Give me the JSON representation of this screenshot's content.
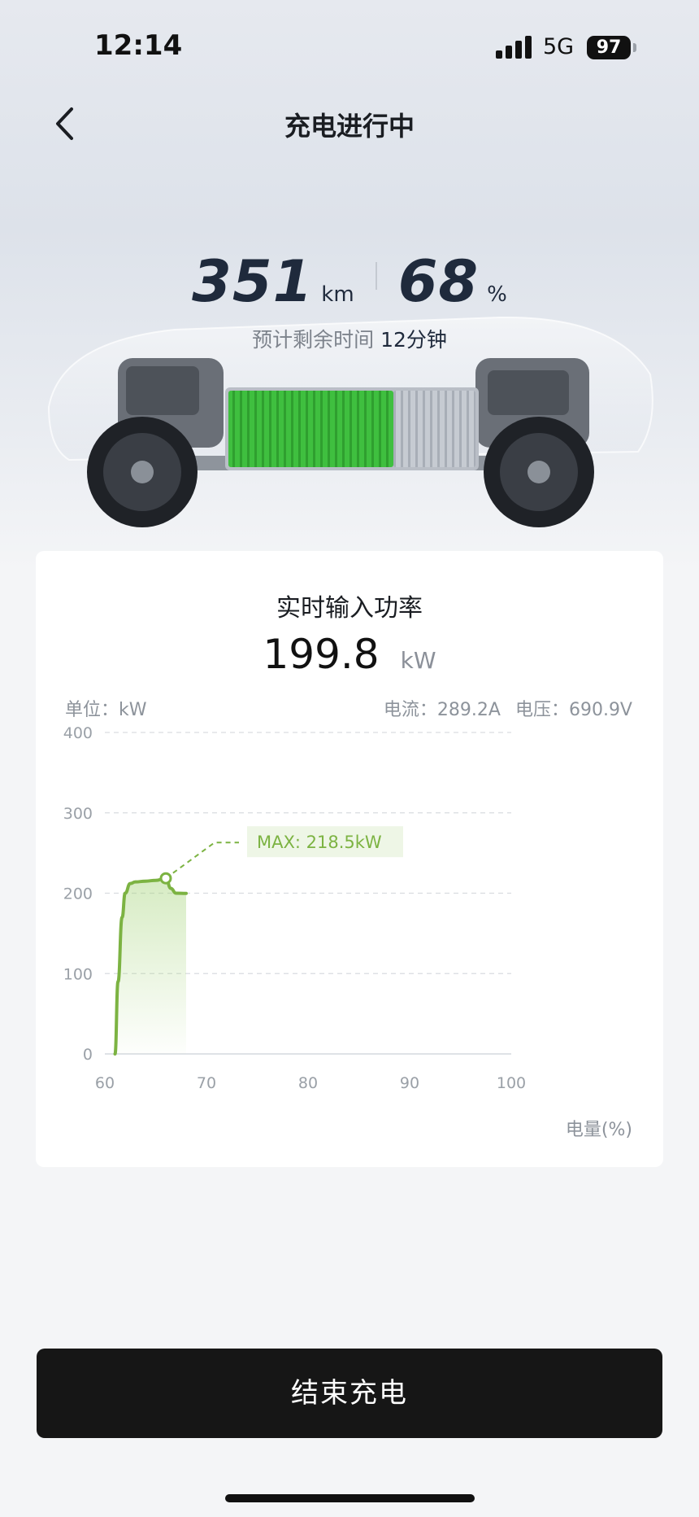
{
  "status_bar": {
    "time": "12:14",
    "network": "5G",
    "battery": "97"
  },
  "nav": {
    "title": "充电进行中",
    "back_icon": "chevron-left-icon"
  },
  "summary": {
    "range_value": "351",
    "range_unit": "km",
    "soc_value": "68",
    "soc_unit": "%",
    "remaining_label": "预计剩余时间",
    "remaining_value": "12分钟"
  },
  "power_card": {
    "title": "实时输入功率",
    "value": "199.8",
    "unit": "kW",
    "unit_label": "单位：kW",
    "current": "电流：289.2A",
    "voltage": "电压：690.9V",
    "x_axis_label": "电量(%)",
    "max_label": "MAX: 218.5kW"
  },
  "chart_data": {
    "type": "area",
    "xlabel": "电量(%)",
    "ylabel": "单位：kW",
    "xlim": [
      60,
      100
    ],
    "ylim": [
      0,
      400
    ],
    "x_ticks": [
      "60",
      "70",
      "80",
      "90",
      "100"
    ],
    "y_ticks": [
      "0",
      "100",
      "200",
      "300",
      "400"
    ],
    "grid": true,
    "color": "#7cb342",
    "series": [
      {
        "x": [
          61,
          61.3,
          61.7,
          62,
          62.5,
          63,
          64,
          65,
          66,
          66.5,
          67,
          68
        ],
        "y": [
          0,
          90,
          170,
          200,
          212,
          214,
          215,
          216,
          218.5,
          206,
          200,
          199.8
        ]
      }
    ],
    "max_point": {
      "x": 66,
      "y": 218.5
    }
  },
  "actions": {
    "end_label": "结束充电"
  }
}
